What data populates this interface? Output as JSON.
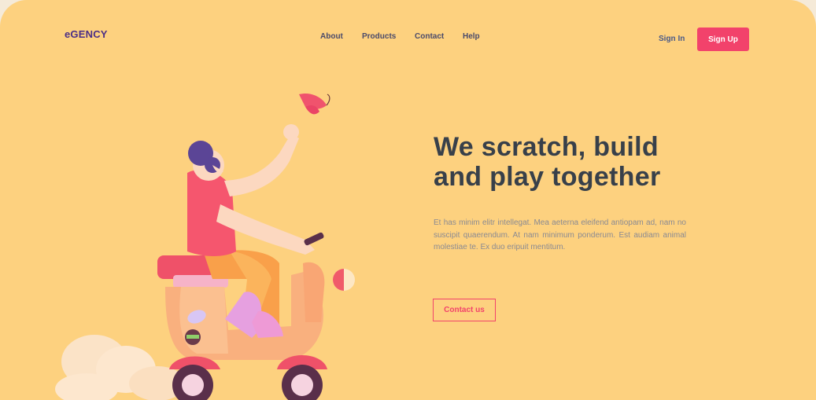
{
  "brand": {
    "logo": "eGENCY"
  },
  "nav": {
    "items": [
      {
        "label": "About"
      },
      {
        "label": "Products"
      },
      {
        "label": "Contact"
      },
      {
        "label": "Help"
      }
    ]
  },
  "auth": {
    "sign_in": "Sign In",
    "sign_up": "Sign Up"
  },
  "hero": {
    "headline_line1": "We scratch, build",
    "headline_line2": "and play together",
    "body": "Et has minim elitr intellegat. Mea aeterna eleifend antiopam ad, nam no suscipit quaerendum. At nam minimum ponderum. Est audiam animal molestiae te. Ex duo eripuit mentitum.",
    "cta": "Contact us",
    "illustration": "girl-on-scooter-with-butterfly"
  },
  "colors": {
    "background": "#fdd17f",
    "accent": "#f2426b",
    "heading": "#38404a",
    "logo": "#4b2e86"
  }
}
